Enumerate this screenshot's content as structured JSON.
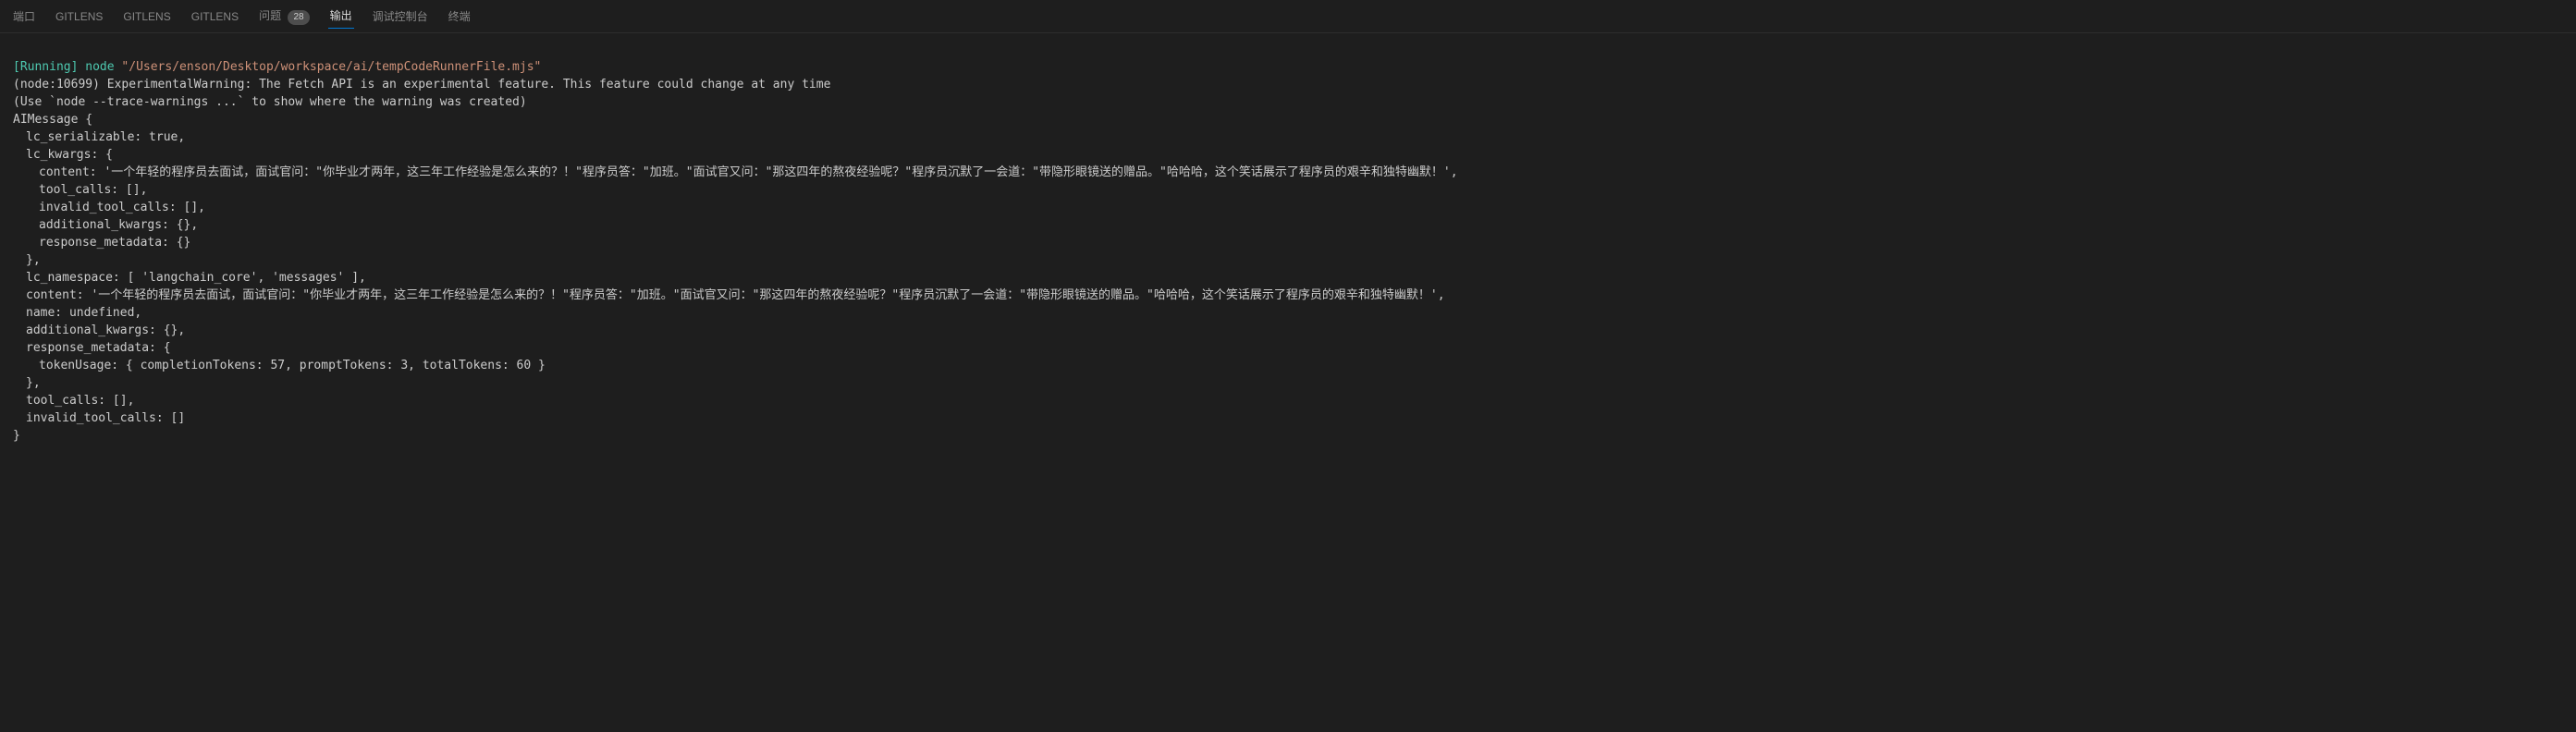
{
  "tabs": {
    "port": "端口",
    "gitlens1": "GITLENS",
    "gitlens2": "GITLENS",
    "gitlens3": "GITLENS",
    "problems": "问题",
    "problems_count": "28",
    "output": "输出",
    "debug_console": "调试控制台",
    "terminal": "终端"
  },
  "output": {
    "running_label": "[Running]",
    "node_label": "node",
    "file_path": "\"/Users/enson/Desktop/workspace/ai/tempCodeRunnerFile.mjs\"",
    "warning_line": "(node:10699) ExperimentalWarning: The Fetch API is an experimental feature. This feature could change at any time",
    "trace_hint": "(Use `node --trace-warnings ...` to show where the warning was created)",
    "obj_open": "AIMessage {",
    "lc_serializable": "lc_serializable: true,",
    "lc_kwargs_open": "lc_kwargs: {",
    "content1": "content: '一个年轻的程序员去面试，面试官问：\"你毕业才两年，这三年工作经验是怎么来的？！\"程序员答：\"加班。\"面试官又问：\"那这四年的熬夜经验呢？\"程序员沉默了一会道：\"带隐形眼镜送的赠品。\"哈哈哈，这个笑话展示了程序员的艰辛和独特幽默！',",
    "tool_calls1": "tool_calls: [],",
    "invalid_tool_calls1": "invalid_tool_calls: [],",
    "additional_kwargs1": "additional_kwargs: {},",
    "response_metadata1": "response_metadata: {}",
    "lc_kwargs_close": "},",
    "lc_namespace": "lc_namespace: [ 'langchain_core', 'messages' ],",
    "content2": "content: '一个年轻的程序员去面试，面试官问：\"你毕业才两年，这三年工作经验是怎么来的？！\"程序员答：\"加班。\"面试官又问：\"那这四年的熬夜经验呢？\"程序员沉默了一会道：\"带隐形眼镜送的赠品。\"哈哈哈，这个笑话展示了程序员的艰辛和独特幽默！',",
    "name_line": "name: undefined,",
    "additional_kwargs2": "additional_kwargs: {},",
    "response_metadata_open": "response_metadata: {",
    "token_usage": "tokenUsage: { completionTokens: 57, promptTokens: 3, totalTokens: 60 }",
    "response_metadata_close": "},",
    "tool_calls2": "tool_calls: [],",
    "invalid_tool_calls2": "invalid_tool_calls: []",
    "obj_close": "}"
  }
}
